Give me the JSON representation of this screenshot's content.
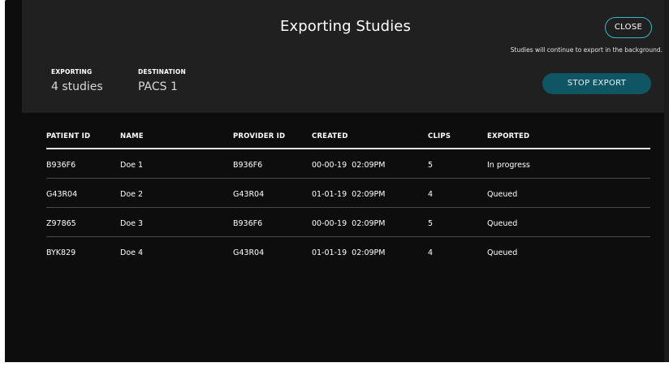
{
  "dialog": {
    "title": "Exporting Studies",
    "close_label": "CLOSE",
    "background_note": "Studies will continue to export in the background.",
    "exporting_label": "EXPORTING",
    "exporting_value": "4 studies",
    "destination_label": "DESTINATION",
    "destination_value": "PACS 1",
    "stop_label": "STOP EXPORT"
  },
  "table": {
    "columns": [
      "PATIENT ID",
      "NAME",
      "PROVIDER ID",
      "CREATED",
      "CLIPS",
      "EXPORTED"
    ],
    "rows": [
      [
        "B936F6",
        "Doe 1",
        "B936F6",
        "00-00-19  02:09PM",
        "5",
        "In progress"
      ],
      [
        "G43R04",
        "Doe 2",
        "G43R04",
        "01-01-19  02:09PM",
        "4",
        "Queued"
      ],
      [
        "Z97865",
        "Doe 3",
        "B936F6",
        "00-00-19  02:09PM",
        "5",
        "Queued"
      ],
      [
        "BYK829",
        "Doe 4",
        "G43R04",
        "01-01-19  02:09PM",
        "4",
        "Queued"
      ]
    ]
  },
  "colors": {
    "accent_outline": "#3bb3c8",
    "stop_button_bg": "#0f5563",
    "header_bg": "#202020",
    "body_bg": "#0d0d0d"
  }
}
